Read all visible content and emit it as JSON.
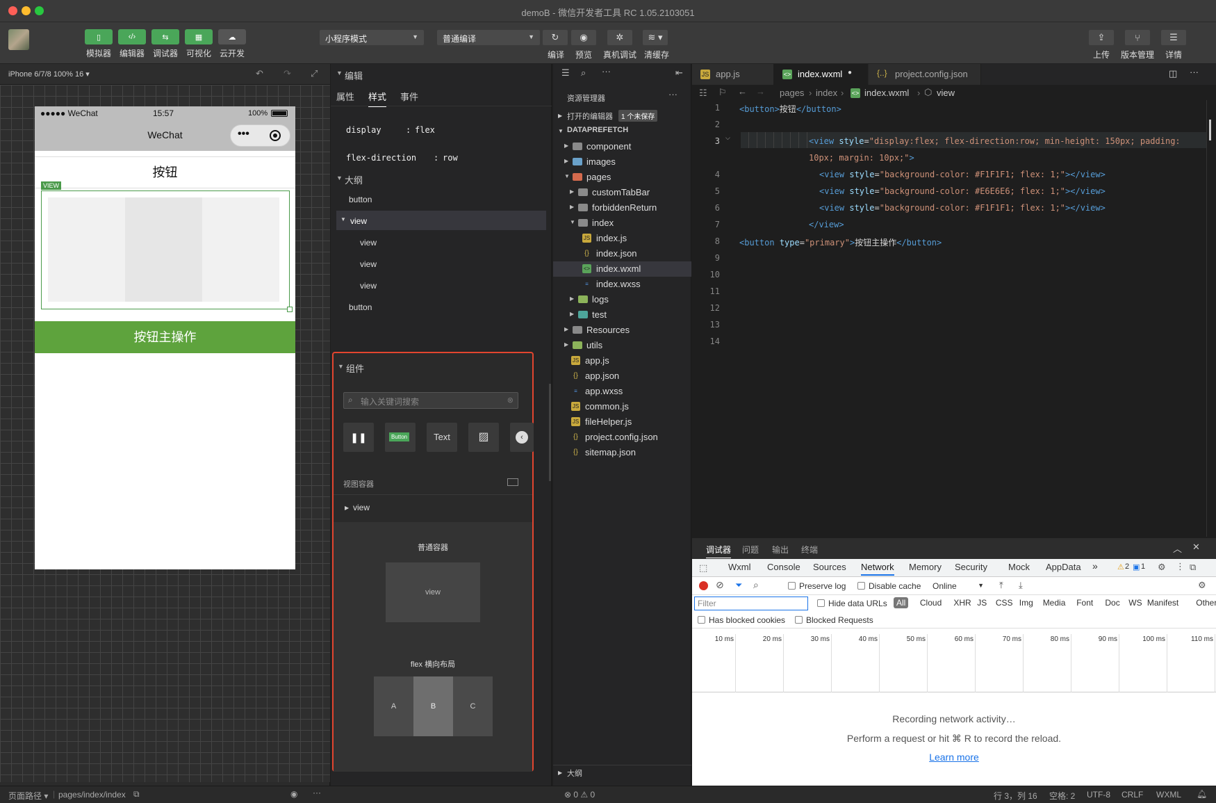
{
  "window": {
    "title": "demoB - 微信开发者工具 RC 1.05.2103051"
  },
  "toolbar": {
    "left_buttons": [
      {
        "label": "模拟器"
      },
      {
        "label": "编辑器"
      },
      {
        "label": "调试器"
      },
      {
        "label": "可视化"
      },
      {
        "label": "云开发"
      }
    ],
    "mode_select": "小程序模式",
    "compile_select": "普通编译",
    "mid_buttons": [
      {
        "label": "编译"
      },
      {
        "label": "预览"
      },
      {
        "label": "真机调试"
      },
      {
        "label": "清缓存"
      }
    ],
    "right_buttons": [
      {
        "label": "上传"
      },
      {
        "label": "版本管理"
      },
      {
        "label": "详情"
      }
    ]
  },
  "simulator": {
    "device": "iPhone 6/7/8 100% 16 ▾",
    "status_carrier": "●●●●● WeChat",
    "status_time": "15:57",
    "status_battery": "100%",
    "nav_title": "WeChat",
    "capsule_dots": "•••",
    "button1": "按钮",
    "view_tag": "VIEW",
    "primary_button": "按钮主操作"
  },
  "wxml_panel": {
    "section_edit": "编辑",
    "tabs": [
      "属性",
      "样式",
      "事件"
    ],
    "styles": [
      {
        "prop": "display",
        "val": "flex"
      },
      {
        "prop": "flex-direction",
        "val": "row"
      }
    ],
    "section_outline": "大纲",
    "outline": [
      "button",
      "view",
      "view",
      "view",
      "view",
      "button"
    ],
    "section_components": "组件",
    "search_placeholder": "输入关键词搜索",
    "comp_text": "Text",
    "comp_button": "Button",
    "view_container": "视图容器",
    "view_item": "view",
    "card1_title": "普通容器",
    "card1_box": "view",
    "card2_title": "flex 横向布局",
    "flex_cells": [
      "A",
      "B",
      "C"
    ]
  },
  "explorer": {
    "title": "资源管理器",
    "open_editors": "打开的编辑器",
    "unsaved_badge": "1 个未保存",
    "project": "DATAPREFETCH",
    "items": [
      {
        "name": "component",
        "kind": "folder",
        "depth": 0
      },
      {
        "name": "images",
        "kind": "folder",
        "depth": 0
      },
      {
        "name": "pages",
        "kind": "folder-open",
        "depth": 0
      },
      {
        "name": "customTabBar",
        "kind": "folder",
        "depth": 1
      },
      {
        "name": "forbiddenReturn",
        "kind": "folder",
        "depth": 1
      },
      {
        "name": "index",
        "kind": "folder-open",
        "depth": 1
      },
      {
        "name": "index.js",
        "kind": "js",
        "depth": 2
      },
      {
        "name": "index.json",
        "kind": "json",
        "depth": 2
      },
      {
        "name": "index.wxml",
        "kind": "wxml",
        "depth": 2
      },
      {
        "name": "index.wxss",
        "kind": "wxss",
        "depth": 2
      },
      {
        "name": "logs",
        "kind": "folder",
        "depth": 1
      },
      {
        "name": "test",
        "kind": "folder",
        "depth": 1
      },
      {
        "name": "Resources",
        "kind": "folder",
        "depth": 0
      },
      {
        "name": "utils",
        "kind": "folder",
        "depth": 0
      },
      {
        "name": "app.js",
        "kind": "js",
        "depth": 0
      },
      {
        "name": "app.json",
        "kind": "json",
        "depth": 0
      },
      {
        "name": "app.wxss",
        "kind": "wxss",
        "depth": 0
      },
      {
        "name": "common.js",
        "kind": "js",
        "depth": 0
      },
      {
        "name": "fileHelper.js",
        "kind": "js",
        "depth": 0
      },
      {
        "name": "project.config.json",
        "kind": "json",
        "depth": 0
      },
      {
        "name": "sitemap.json",
        "kind": "json",
        "depth": 0
      }
    ],
    "outline_footer": "大纲",
    "problems": "⊗ 0 ⚠ 0"
  },
  "editor": {
    "tabs": [
      "app.js",
      "index.wxml",
      "project.config.json"
    ],
    "breadcrumb": [
      "pages",
      "index",
      "index.wxml",
      "view"
    ],
    "line_numbers": [
      "1",
      "2",
      "3",
      "4",
      "5",
      "6",
      "7",
      "8",
      "9",
      "10",
      "11",
      "12",
      "13",
      "14"
    ]
  },
  "devtools": {
    "top_tabs": [
      "调试器",
      "问题",
      "输出",
      "终端"
    ],
    "tabs": [
      "Wxml",
      "Console",
      "Sources",
      "Network",
      "Memory",
      "Security",
      "Mock",
      "AppData"
    ],
    "active_tab": "Network",
    "warn_count": "2",
    "info_count": "1",
    "preserve_log": "Preserve log",
    "disable_cache": "Disable cache",
    "throttle": "Online",
    "filter_placeholder": "Filter",
    "hide_data_urls": "Hide data URLs",
    "types": [
      "All",
      "Cloud",
      "XHR",
      "JS",
      "CSS",
      "Img",
      "Media",
      "Font",
      "Doc",
      "WS",
      "Manifest",
      "Other"
    ],
    "blocked_cookies": "Has blocked cookies",
    "blocked_requests": "Blocked Requests",
    "timeline": [
      "10 ms",
      "20 ms",
      "30 ms",
      "40 ms",
      "50 ms",
      "60 ms",
      "70 ms",
      "80 ms",
      "90 ms",
      "100 ms",
      "110 ms"
    ],
    "recording": "Recording network activity…",
    "hint": "Perform a request or hit ⌘ R to record the reload.",
    "learn_more": "Learn more"
  },
  "footer": {
    "page_path_label": "页面路径 ▾",
    "page_path": "pages/index/index",
    "cursor": "行 3，列 16",
    "spaces": "空格: 2",
    "encoding": "UTF-8",
    "eol": "CRLF",
    "lang": "WXML"
  }
}
